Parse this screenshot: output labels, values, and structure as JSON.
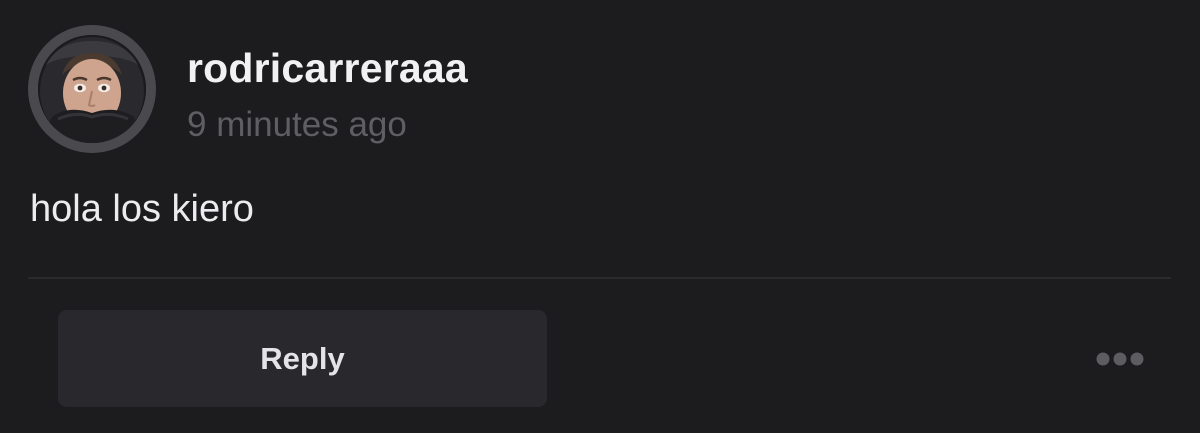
{
  "post": {
    "author": {
      "username": "rodricarreraaa",
      "avatar_icon": "profile-photo"
    },
    "timestamp": "9 minutes ago",
    "text": "hola los kiero"
  },
  "actions": {
    "reply_label": "Reply",
    "more_icon": "ellipsis-icon"
  },
  "colors": {
    "background": "#1c1c1f",
    "avatar_ring": "#4a4a4e",
    "username": "#f1f1f3",
    "timestamp": "#5e5e63",
    "body_text": "#ececee",
    "divider": "#2a2a2d",
    "reply_button_bg": "#29292d",
    "reply_label": "#e4e4e7",
    "more_dots": "#5c5c61"
  }
}
